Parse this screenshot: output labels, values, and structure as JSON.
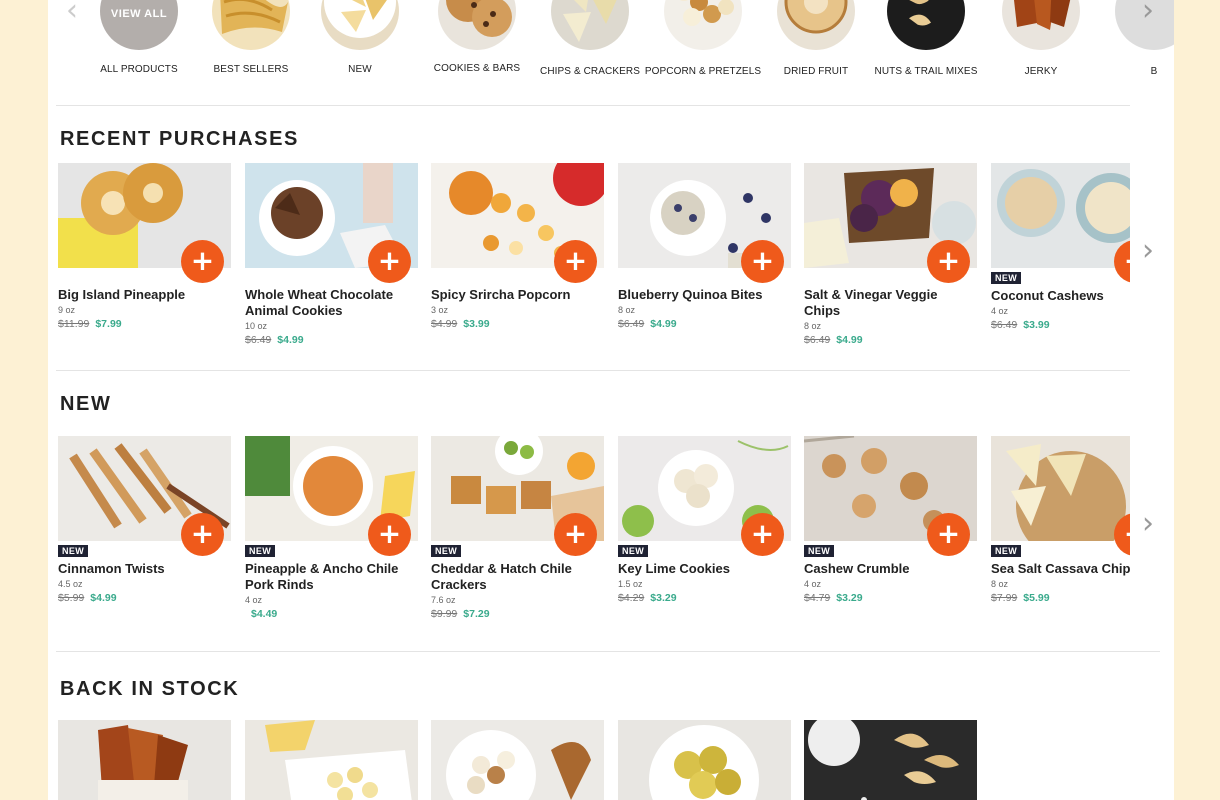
{
  "categories": [
    {
      "label": "ALL PRODUCTS",
      "circle_text": "VIEW ALL",
      "icon": "view-all"
    },
    {
      "label": "BEST SELLERS",
      "icon": "pasta-chips"
    },
    {
      "label": "NEW",
      "icon": "chips-bowl"
    },
    {
      "label": "COOKIES & BARS",
      "icon": "cookies"
    },
    {
      "label": "CHIPS & CRACKERS",
      "icon": "chips"
    },
    {
      "label": "POPCORN & PRETZELS",
      "icon": "popcorn"
    },
    {
      "label": "DRIED FRUIT",
      "icon": "dried-apple"
    },
    {
      "label": "NUTS & TRAIL MIXES",
      "icon": "cashews"
    },
    {
      "label": "JERKY",
      "icon": "jerky"
    },
    {
      "label": "B",
      "icon": "partial"
    }
  ],
  "sections": {
    "recent": {
      "title": "RECENT PURCHASES"
    },
    "new": {
      "title": "NEW"
    },
    "back": {
      "title": "BACK IN STOCK"
    }
  },
  "recent": [
    {
      "name": "Big Island Pineapple",
      "size": "9 oz",
      "old_price": "$11.99",
      "price": "$7.99",
      "badge": ""
    },
    {
      "name": "Whole Wheat Chocolate Animal Cookies",
      "size": "10 oz",
      "old_price": "$6.49",
      "price": "$4.99",
      "badge": ""
    },
    {
      "name": "Spicy Srircha Popcorn",
      "size": "3 oz",
      "old_price": "$4.99",
      "price": "$3.99",
      "badge": ""
    },
    {
      "name": "Blueberry Quinoa Bites",
      "size": "8 oz",
      "old_price": "$6.49",
      "price": "$4.99",
      "badge": ""
    },
    {
      "name": "Salt & Vinegar Veggie Chips",
      "size": "8 oz",
      "old_price": "$6.49",
      "price": "$4.99",
      "badge": ""
    },
    {
      "name": "Coconut Cashews",
      "size": "4 oz",
      "old_price": "$6.49",
      "price": "$3.99",
      "badge": "NEW"
    }
  ],
  "new": [
    {
      "name": "Cinnamon Twists",
      "size": "4.5 oz",
      "old_price": "$5.99",
      "price": "$4.99",
      "badge": "NEW"
    },
    {
      "name": "Pineapple & Ancho Chile Pork Rinds",
      "size": "4 oz",
      "old_price": "",
      "price": "$4.49",
      "badge": "NEW"
    },
    {
      "name": "Cheddar & Hatch Chile Crackers",
      "size": "7.6 oz",
      "old_price": "$9.99",
      "price": "$7.29",
      "badge": "NEW"
    },
    {
      "name": "Key Lime Cookies",
      "size": "1.5 oz",
      "old_price": "$4.29",
      "price": "$3.29",
      "badge": "NEW"
    },
    {
      "name": "Cashew Crumble",
      "size": "4 oz",
      "old_price": "$4.79",
      "price": "$3.29",
      "badge": "NEW"
    },
    {
      "name": "Sea Salt Cassava Chips",
      "size": "8 oz",
      "old_price": "$7.99",
      "price": "$5.99",
      "badge": "NEW"
    }
  ],
  "back": [
    {
      "icon": "jerky"
    },
    {
      "icon": "pasta"
    },
    {
      "icon": "popcorn-caramel"
    },
    {
      "icon": "banana-chips"
    },
    {
      "icon": "cashews-salt"
    }
  ],
  "add_symbol": "+",
  "icons": {
    "prev": "chevron-left-icon",
    "next": "chevron-right-icon"
  },
  "colors": {
    "accent": "#ef5a1b",
    "price_green": "#3aaa8c",
    "background": "#fdf1d4",
    "badge": "#1f2233"
  }
}
